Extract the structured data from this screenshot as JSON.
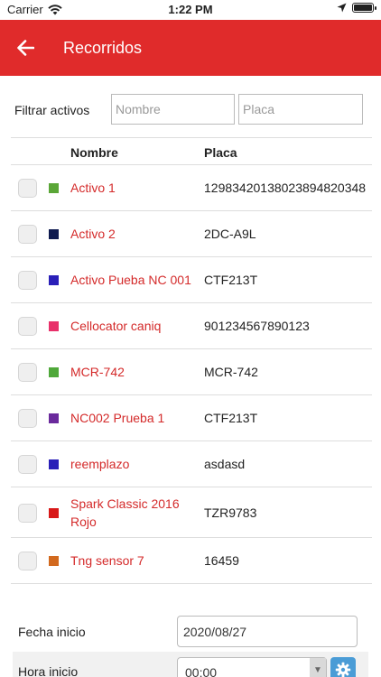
{
  "status_bar": {
    "carrier": "Carrier",
    "time": "1:22 PM"
  },
  "header": {
    "title": "Recorridos",
    "color": "#e02b2b"
  },
  "filter": {
    "label": "Filtrar activos",
    "name_placeholder": "Nombre",
    "plate_placeholder": "Placa"
  },
  "table": {
    "columns": [
      "Nombre",
      "Placa"
    ],
    "rows": [
      {
        "name": "Activo 1",
        "plate": "1298342013802389482034​8",
        "color": "#5aa637"
      },
      {
        "name": "Activo 2",
        "plate": "2DC-A9L",
        "color": "#0e1a4f"
      },
      {
        "name": "Activo Pueba NC 001",
        "plate": "CTF213T",
        "color": "#2a1fb8"
      },
      {
        "name": "Cellocator caniq",
        "plate": "901234567890123",
        "color": "#e8306a"
      },
      {
        "name": "MCR-742",
        "plate": "MCR-742",
        "color": "#4fa83a"
      },
      {
        "name": "NC002 Prueba 1",
        "plate": "CTF213T",
        "color": "#6a2a9c"
      },
      {
        "name": "reemplazo",
        "plate": "asdasd",
        "color": "#2a1fb8"
      },
      {
        "name": "Spark Classic 2016 Rojo",
        "plate": "TZR9783",
        "color": "#d81818"
      },
      {
        "name": "Tng sensor 7",
        "plate": "16459",
        "color": "#d2691e"
      }
    ]
  },
  "dates": {
    "start_date_label": "Fecha inicio",
    "start_date_value": "2020/08/27",
    "start_time_label": "Hora inicio",
    "start_time_value": "00:00"
  }
}
